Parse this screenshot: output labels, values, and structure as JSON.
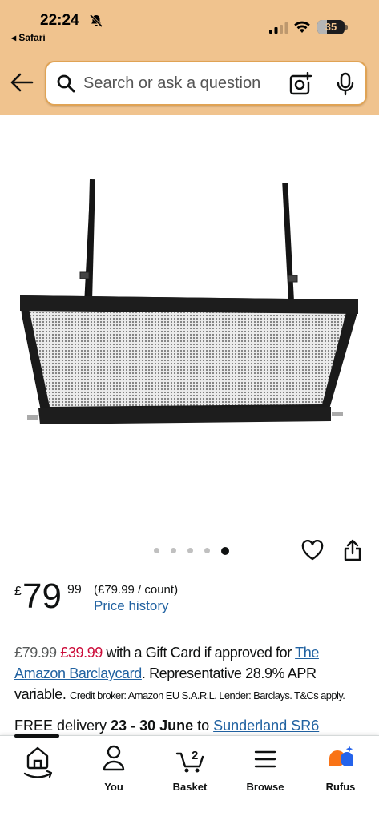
{
  "status": {
    "time": "22:24",
    "back_app": "◂ Safari",
    "battery": "35",
    "battery_level": 0.35
  },
  "search": {
    "placeholder": "Search or ask a question"
  },
  "carousel": {
    "total": 5,
    "active_index": 4
  },
  "price": {
    "symbol": "£",
    "whole": "79",
    "fraction": "99",
    "unit_price": "(£79.99 / count)",
    "history_link": "Price history"
  },
  "offer": {
    "old_price": "£79.99",
    "new_price": "£39.99",
    "text1": " with a Gift Card if approved for ",
    "link": "The Amazon Barclaycard",
    "text2": ". Representative 28.9% APR variable. ",
    "small_text": "Credit broker: Amazon EU S.A.R.L. Lender: Barclays. T&Cs apply."
  },
  "delivery": {
    "prefix": "FREE delivery ",
    "dates": "23 - 30 June",
    "to": " to ",
    "location": "Sunderland SR6"
  },
  "nav": {
    "home": "",
    "you": "You",
    "basket": "Basket",
    "basket_count": "2",
    "browse": "Browse",
    "rufus": "Rufus"
  },
  "colors": {
    "header_bg": "#f0c38e",
    "link": "#2162a1",
    "sale": "#cc0c39",
    "rufus_orange": "#f97316",
    "rufus_blue": "#2563eb"
  },
  "icons": [
    "bell-off-icon",
    "signal-icon",
    "wifi-icon",
    "back-arrow-icon",
    "search-icon",
    "camera-icon",
    "mic-icon",
    "heart-icon",
    "share-icon",
    "home-icon",
    "user-icon",
    "basket-icon",
    "menu-icon",
    "rufus-icon"
  ]
}
